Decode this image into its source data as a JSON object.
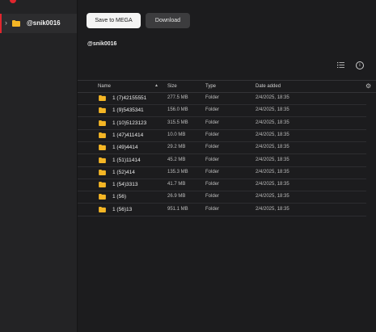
{
  "sidebar": {
    "item": {
      "label": "@snik0016"
    }
  },
  "toolbar": {
    "save_label": "Save to MEGA",
    "download_label": "Download"
  },
  "breadcrumb": "@snik0016",
  "table": {
    "headers": {
      "name": "Name",
      "size": "Size",
      "type": "Type",
      "date": "Date added"
    },
    "rows": [
      {
        "name": "1 (7)42155551",
        "size": "277.5 MB",
        "type": "Folder",
        "date": "2/4/2025, 18:35"
      },
      {
        "name": "1 (9)5435341",
        "size": "156.0 MB",
        "type": "Folder",
        "date": "2/4/2025, 18:35"
      },
      {
        "name": "1 (10)5123123",
        "size": "315.5 MB",
        "type": "Folder",
        "date": "2/4/2025, 18:35"
      },
      {
        "name": "1 (47)411414",
        "size": "10.0 MB",
        "type": "Folder",
        "date": "2/4/2025, 18:35"
      },
      {
        "name": "1 (49)4414",
        "size": "29.2 MB",
        "type": "Folder",
        "date": "2/4/2025, 18:35"
      },
      {
        "name": "1 (51)11414",
        "size": "45.2 MB",
        "type": "Folder",
        "date": "2/4/2025, 18:35"
      },
      {
        "name": "1 (52)414",
        "size": "135.3 MB",
        "type": "Folder",
        "date": "2/4/2025, 18:35"
      },
      {
        "name": "1 (54)3313",
        "size": "41.7 MB",
        "type": "Folder",
        "date": "2/4/2025, 18:35"
      },
      {
        "name": "1 (56)",
        "size": "26.9 MB",
        "type": "Folder",
        "date": "2/4/2025, 18:35"
      },
      {
        "name": "1 (56)13",
        "size": "951.1 MB",
        "type": "Folder",
        "date": "2/4/2025, 18:35"
      }
    ]
  },
  "icons": {
    "folder": "folder-icon",
    "chevron": "chevron-right-icon",
    "list_view": "list-view-icon",
    "info": "info-icon",
    "settings": "gear-icon",
    "sort": "sort-ascending-icon"
  },
  "colors": {
    "accent": "#e0262e",
    "folder": "#f5b625"
  }
}
